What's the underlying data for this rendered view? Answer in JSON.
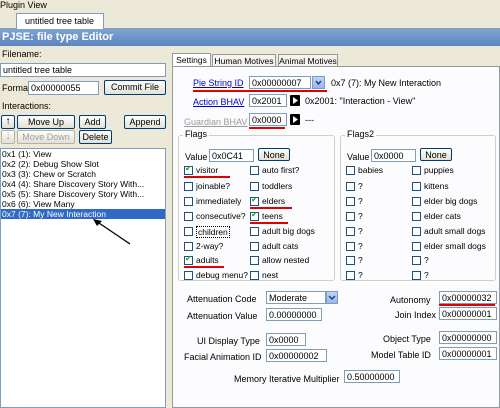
{
  "window": {
    "title": "Plugin View"
  },
  "doc_tab": {
    "label": "untitled tree table"
  },
  "editor": {
    "title": "PJSE: file type Editor"
  },
  "left": {
    "filename_label": "Filename:",
    "filename_value": "untitled tree table",
    "format_label": "Format",
    "format_value": "0x00000055",
    "commit_label": "Commit File",
    "interactions_label": "Interactions:",
    "move_up_label": "Move Up",
    "add_label": "Add",
    "append_label": "Append",
    "move_down_label": "Move Down",
    "delete_label": "Delete",
    "items": [
      "0x1 (1): View",
      "0x2 (2): Debug Show Slot",
      "0x3 (3): Chew or Scratch",
      "0x4 (4): Share Discovery Story With...",
      "0x5 (5): Share Discovery Story With...",
      "0x6 (6): View Many",
      "0x7 (7): My New Interaction"
    ]
  },
  "tabs": {
    "settings": "Settings",
    "human": "Human Motives",
    "animal": "Animal Motives"
  },
  "settings": {
    "pie_label": "Pie String ID",
    "pie_value": "0x00000007",
    "pie_desc": "0x7 (7): My New Interaction",
    "action_label": "Action BHAV",
    "action_value": "0x2001",
    "action_desc": "0x2001: \"Interaction - View\"",
    "guardian_label": "Guardian BHAV",
    "guardian_value": "0x0000",
    "guardian_desc": "---",
    "flags_title": "Flags",
    "flags_value_label": "Value",
    "flags_value": "0x0C41",
    "flags_none": "None",
    "flags": [
      {
        "label": "visitor",
        "checked": true
      },
      {
        "label": "auto first?",
        "checked": false
      },
      {
        "label": "joinable?",
        "checked": false
      },
      {
        "label": "toddlers",
        "checked": false
      },
      {
        "label": "immediately",
        "checked": false
      },
      {
        "label": "elders",
        "checked": true
      },
      {
        "label": "consecutive?",
        "checked": false
      },
      {
        "label": "teens",
        "checked": true
      },
      {
        "label": "children",
        "checked": false
      },
      {
        "label": "adult big dogs",
        "checked": false
      },
      {
        "label": "2-way?",
        "checked": false
      },
      {
        "label": "adult cats",
        "checked": false
      },
      {
        "label": "adults",
        "checked": true
      },
      {
        "label": "allow nested",
        "checked": false
      },
      {
        "label": "debug menu?",
        "checked": false
      },
      {
        "label": "nest",
        "checked": false
      }
    ],
    "flags2_title": "Flags2",
    "flags2_value_label": "Value",
    "flags2_value": "0x0000",
    "flags2_none": "None",
    "flags2": [
      {
        "label": "babies",
        "checked": false
      },
      {
        "label": "puppies",
        "checked": false
      },
      {
        "label": "?",
        "checked": false
      },
      {
        "label": "kittens",
        "checked": false
      },
      {
        "label": "?",
        "checked": false
      },
      {
        "label": "elder big dogs",
        "checked": false
      },
      {
        "label": "?",
        "checked": false
      },
      {
        "label": "elder cats",
        "checked": false
      },
      {
        "label": "?",
        "checked": false
      },
      {
        "label": "adult small dogs",
        "checked": false
      },
      {
        "label": "?",
        "checked": false
      },
      {
        "label": "elder small dogs",
        "checked": false
      },
      {
        "label": "?",
        "checked": false
      },
      {
        "label": "?",
        "checked": false
      },
      {
        "label": "?",
        "checked": false
      },
      {
        "label": "?",
        "checked": false
      }
    ],
    "attenuation_code_label": "Attenuation Code",
    "attenuation_code_value": "Moderate",
    "autonomy_label": "Autonomy",
    "autonomy_value": "0x00000032",
    "attenuation_value_label": "Attenuation Value",
    "attenuation_value": "0.00000000",
    "join_index_label": "Join Index",
    "join_index_value": "0x00000001",
    "ui_display_label": "UI Display Type",
    "ui_display_value": "0x0000",
    "object_type_label": "Object Type",
    "object_type_value": "0x00000000",
    "facial_label": "Facial Animation ID",
    "facial_value": "0x00000002",
    "model_table_label": "Model Table ID",
    "model_table_value": "0x00000001",
    "memory_label": "Memory Iterative Multiplier",
    "memory_value": "0.50000000"
  },
  "colors": {
    "highlight": "#316ac5",
    "annotation_red": "#e00000",
    "title_bar": "#5c85c0"
  }
}
